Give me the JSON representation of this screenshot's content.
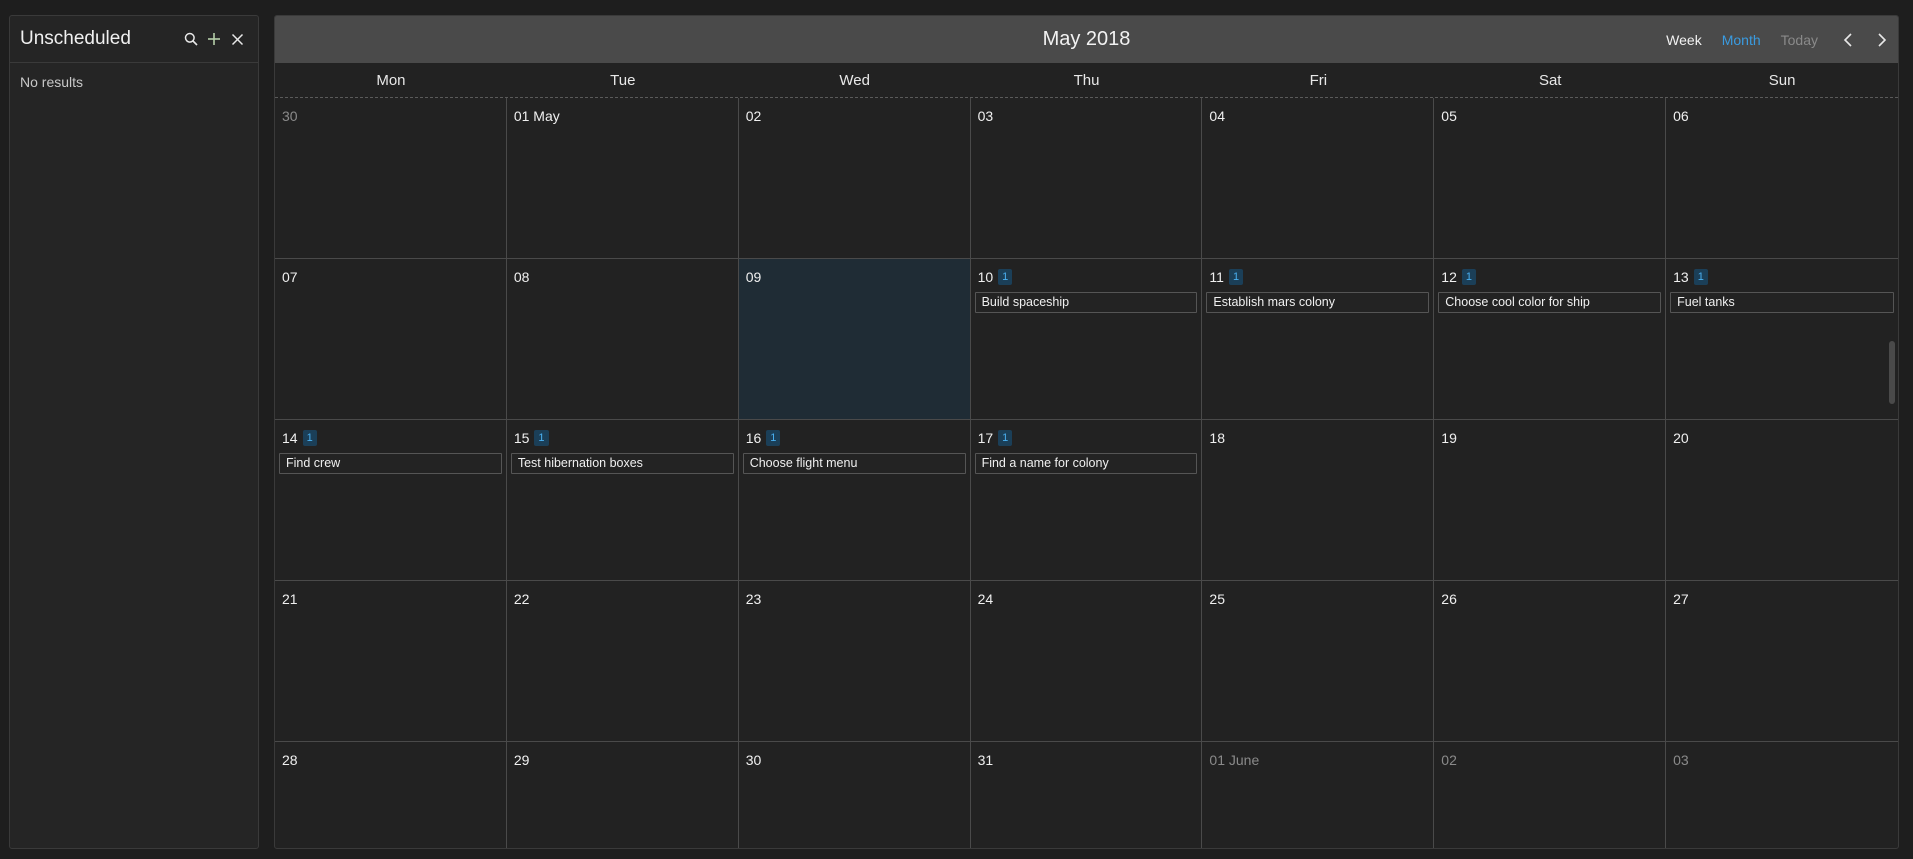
{
  "sidebar": {
    "title": "Unscheduled",
    "no_results": "No results",
    "icons": [
      "search-icon",
      "plus-icon",
      "close-icon"
    ],
    "accent_plus": "#b5cea8"
  },
  "calendar": {
    "title": "May 2018",
    "views": {
      "week": "Week",
      "month": "Month",
      "today": "Today"
    },
    "active_view": "Month",
    "accent": "#3a9be0",
    "weekdays": [
      "Mon",
      "Tue",
      "Wed",
      "Thu",
      "Fri",
      "Sat",
      "Sun"
    ],
    "today": "09",
    "weeks": [
      [
        {
          "label": "30",
          "outside": true
        },
        {
          "label": "01 May"
        },
        {
          "label": "02"
        },
        {
          "label": "03"
        },
        {
          "label": "04"
        },
        {
          "label": "05"
        },
        {
          "label": "06"
        }
      ],
      [
        {
          "label": "07"
        },
        {
          "label": "08"
        },
        {
          "label": "09",
          "today": true
        },
        {
          "label": "10",
          "badge": "1",
          "events": [
            "Build spaceship"
          ]
        },
        {
          "label": "11",
          "badge": "1",
          "events": [
            "Establish mars colony"
          ]
        },
        {
          "label": "12",
          "badge": "1",
          "events": [
            "Choose cool color for ship"
          ]
        },
        {
          "label": "13",
          "badge": "1",
          "events": [
            "Fuel tanks"
          ]
        }
      ],
      [
        {
          "label": "14",
          "badge": "1",
          "events": [
            "Find crew"
          ]
        },
        {
          "label": "15",
          "badge": "1",
          "events": [
            "Test hibernation boxes"
          ]
        },
        {
          "label": "16",
          "badge": "1",
          "events": [
            "Choose flight menu"
          ]
        },
        {
          "label": "17",
          "badge": "1",
          "events": [
            "Find a name for colony"
          ]
        },
        {
          "label": "18"
        },
        {
          "label": "19"
        },
        {
          "label": "20"
        }
      ],
      [
        {
          "label": "21"
        },
        {
          "label": "22"
        },
        {
          "label": "23"
        },
        {
          "label": "24"
        },
        {
          "label": "25"
        },
        {
          "label": "26"
        },
        {
          "label": "27"
        }
      ],
      [
        {
          "label": "28"
        },
        {
          "label": "29"
        },
        {
          "label": "30"
        },
        {
          "label": "31"
        },
        {
          "label": "01 June",
          "outside": true
        },
        {
          "label": "02",
          "outside": true
        },
        {
          "label": "03",
          "outside": true
        }
      ]
    ]
  }
}
